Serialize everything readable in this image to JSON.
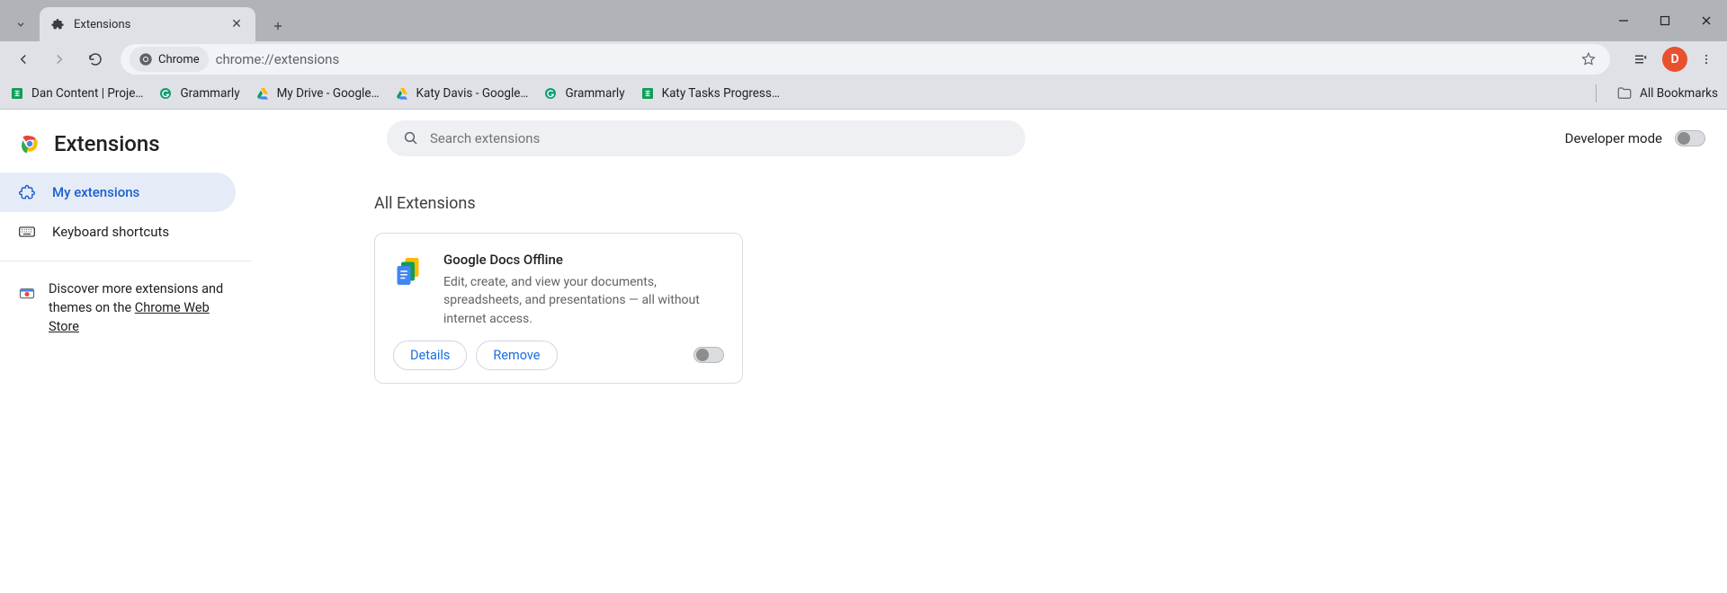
{
  "window": {
    "tab_title": "Extensions",
    "url": "chrome://extensions",
    "site_label": "Chrome",
    "profile_initial": "D",
    "all_bookmarks": "All Bookmarks"
  },
  "bookmarks": [
    {
      "label": "Dan Content | Proje…",
      "icon": "sheets"
    },
    {
      "label": "Grammarly",
      "icon": "grammarly"
    },
    {
      "label": "My Drive - Google…",
      "icon": "drive"
    },
    {
      "label": "Katy Davis - Google…",
      "icon": "drive"
    },
    {
      "label": "Grammarly",
      "icon": "grammarly"
    },
    {
      "label": "Katy Tasks Progress…",
      "icon": "sheets"
    }
  ],
  "page": {
    "title": "Extensions",
    "search_placeholder": "Search extensions",
    "developer_mode_label": "Developer mode",
    "section_title": "All Extensions",
    "sidebar": {
      "my_extensions": "My extensions",
      "keyboard_shortcuts": "Keyboard shortcuts",
      "promo_pre": "Discover more extensions and themes on the ",
      "promo_link": "Chrome Web Store"
    },
    "extension": {
      "name": "Google Docs Offline",
      "description": "Edit, create, and view your documents, spreadsheets, and presentations — all without internet access.",
      "details": "Details",
      "remove": "Remove",
      "enabled": false
    }
  }
}
